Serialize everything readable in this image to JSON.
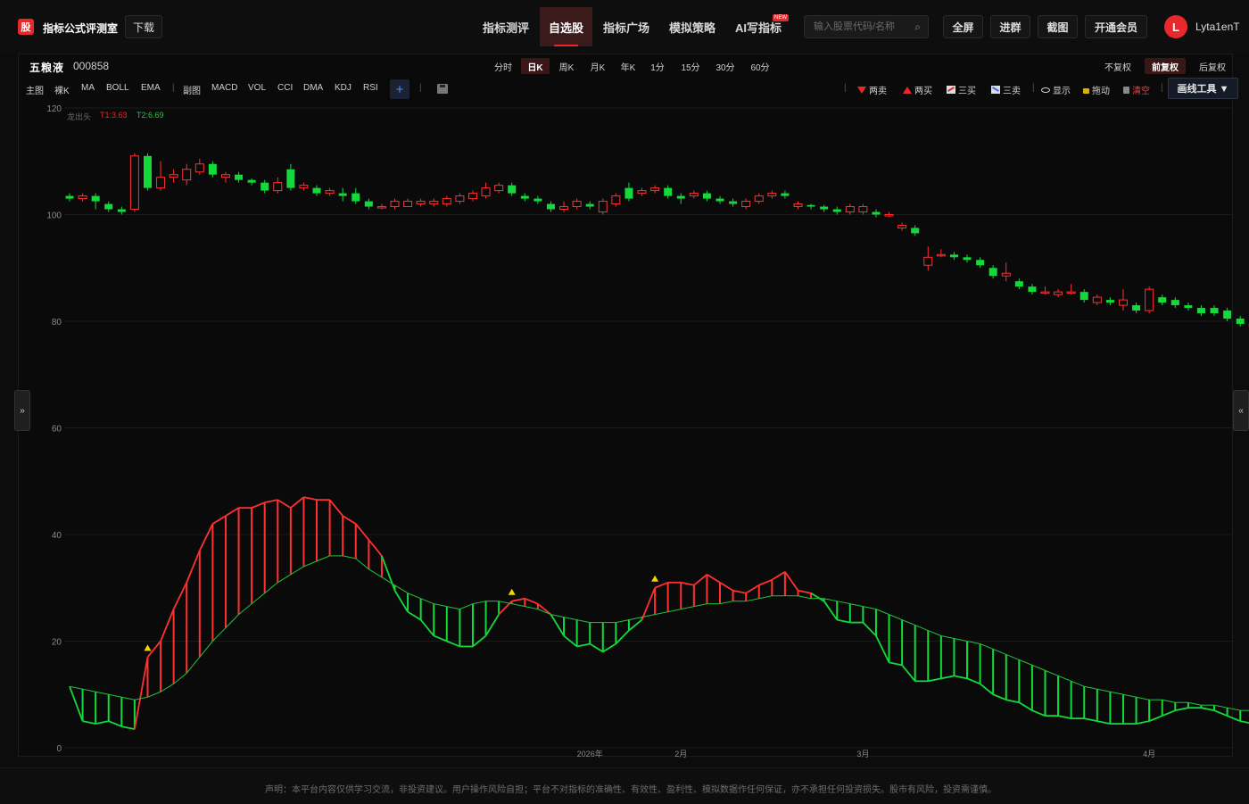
{
  "app": {
    "logo_char": "股",
    "title": "指标公式评测室",
    "download": "下载"
  },
  "nav": [
    "指标测评",
    "自选股",
    "指标广场",
    "模拟策略",
    "AI写指标"
  ],
  "nav_badge": "NEW",
  "search": {
    "placeholder": "输入股票代码/名称"
  },
  "top_buttons": [
    "全屏",
    "进群",
    "截图",
    "开通会员"
  ],
  "user": {
    "initial": "L",
    "name": "Lyta1enT"
  },
  "stock": {
    "name": "五粮液",
    "code": "000858"
  },
  "periods": [
    "分时",
    "日K",
    "周K",
    "月K",
    "年K",
    "1分",
    "15分",
    "30分",
    "60分"
  ],
  "adjust": [
    "不复权",
    "前复权",
    "后复权"
  ],
  "indicators": {
    "main": "主图",
    "bare": "裸K",
    "ma": "MA",
    "boll": "BOLL",
    "ema": "EMA",
    "sub": "副图",
    "macd": "MACD",
    "vol": "VOL",
    "cci": "CCI",
    "dma": "DMA",
    "kdj": "KDJ",
    "rsi": "RSI",
    "plus": "+"
  },
  "signals": {
    "two_sell": "两卖",
    "two_buy": "两买",
    "three_buy": "三买",
    "three_sell": "三卖",
    "show": "显示",
    "drag": "拖动",
    "clear": "清空"
  },
  "draw_tool": "画线工具 ▼",
  "side_left": "»",
  "side_right": "«",
  "legend": {
    "name": "龙出头",
    "t1": "T1:3.63",
    "t2": "T2:6.69"
  },
  "colors": {
    "up": "#ff3030",
    "down": "#13d93a",
    "accent": "#e8282b",
    "t2": "#22cc33"
  },
  "footer": "声明：本平台内容仅供学习交流，非投资建议。用户操作风险自担；平台不对指标的准确性、有效性、盈利性、模拟数据作任何保证，亦不承担任何投资损失。股市有风险，投资需谨慎。",
  "chart_data": {
    "type": "candlestick+indicator",
    "y_ticks": [
      0,
      20,
      40,
      60,
      80,
      100,
      120
    ],
    "ylim": [
      0,
      120
    ],
    "x_ticks": [
      "2026年",
      "2月",
      "3月",
      "4月"
    ],
    "x_tick_index": [
      40,
      47,
      61,
      83
    ],
    "candles": [
      {
        "o": 103.5,
        "c": 103,
        "h": 104,
        "l": 102.5
      },
      {
        "o": 103,
        "c": 103.5,
        "h": 104,
        "l": 102.5
      },
      {
        "o": 103.5,
        "c": 102.5,
        "h": 104,
        "l": 101
      },
      {
        "o": 102,
        "c": 101,
        "h": 102.5,
        "l": 100.5
      },
      {
        "o": 101,
        "c": 100.5,
        "h": 101.5,
        "l": 100
      },
      {
        "o": 101,
        "c": 111,
        "h": 111.5,
        "l": 100.5
      },
      {
        "o": 111,
        "c": 105,
        "h": 111.5,
        "l": 104.5
      },
      {
        "o": 105,
        "c": 107,
        "h": 110,
        "l": 104.5
      },
      {
        "o": 107,
        "c": 107.5,
        "h": 108.5,
        "l": 106
      },
      {
        "o": 106.5,
        "c": 108.5,
        "h": 109.5,
        "l": 105.5
      },
      {
        "o": 108,
        "c": 109.5,
        "h": 110.5,
        "l": 107.5
      },
      {
        "o": 109.5,
        "c": 107.5,
        "h": 110,
        "l": 107
      },
      {
        "o": 107,
        "c": 107.5,
        "h": 108,
        "l": 106
      },
      {
        "o": 107.5,
        "c": 106.5,
        "h": 108,
        "l": 106
      },
      {
        "o": 106.5,
        "c": 106,
        "h": 106.8,
        "l": 105.5
      },
      {
        "o": 106,
        "c": 104.5,
        "h": 106.5,
        "l": 104
      },
      {
        "o": 104.5,
        "c": 106,
        "h": 107,
        "l": 104
      },
      {
        "o": 108.5,
        "c": 105,
        "h": 109.5,
        "l": 104.5
      },
      {
        "o": 105,
        "c": 105.5,
        "h": 106,
        "l": 104.5
      },
      {
        "o": 105,
        "c": 104,
        "h": 105.5,
        "l": 103.5
      },
      {
        "o": 104,
        "c": 104.5,
        "h": 105,
        "l": 103.5
      },
      {
        "o": 104,
        "c": 103.5,
        "h": 105,
        "l": 102.5
      },
      {
        "o": 104,
        "c": 102.5,
        "h": 105,
        "l": 102
      },
      {
        "o": 102.5,
        "c": 101.5,
        "h": 103,
        "l": 101
      },
      {
        "o": 101.5,
        "c": 101.5,
        "h": 102,
        "l": 101
      },
      {
        "o": 101.5,
        "c": 102.5,
        "h": 103,
        "l": 101
      },
      {
        "o": 101.5,
        "c": 102.5,
        "h": 103,
        "l": 101.5
      },
      {
        "o": 102,
        "c": 102.5,
        "h": 103,
        "l": 101.5
      },
      {
        "o": 102,
        "c": 102.5,
        "h": 103,
        "l": 101.5
      },
      {
        "o": 102,
        "c": 103,
        "h": 103.5,
        "l": 101.5
      },
      {
        "o": 102.5,
        "c": 103.5,
        "h": 104,
        "l": 102
      },
      {
        "o": 103,
        "c": 104,
        "h": 104.5,
        "l": 102.5
      },
      {
        "o": 103.5,
        "c": 105,
        "h": 106,
        "l": 103
      },
      {
        "o": 104.5,
        "c": 105.5,
        "h": 106,
        "l": 104
      },
      {
        "o": 105.5,
        "c": 104,
        "h": 106,
        "l": 103.5
      },
      {
        "o": 103.5,
        "c": 103,
        "h": 104,
        "l": 102.5
      },
      {
        "o": 103,
        "c": 102.5,
        "h": 103.5,
        "l": 102
      },
      {
        "o": 102,
        "c": 101,
        "h": 102.5,
        "l": 100.5
      },
      {
        "o": 101,
        "c": 101.5,
        "h": 102.5,
        "l": 100.5
      },
      {
        "o": 101.5,
        "c": 102.5,
        "h": 103,
        "l": 101
      },
      {
        "o": 102,
        "c": 101.5,
        "h": 102.5,
        "l": 101
      },
      {
        "o": 100.5,
        "c": 102.5,
        "h": 103,
        "l": 100
      },
      {
        "o": 102,
        "c": 103.5,
        "h": 104,
        "l": 101.5
      },
      {
        "o": 105,
        "c": 103,
        "h": 106,
        "l": 102.5
      },
      {
        "o": 104,
        "c": 104.5,
        "h": 105,
        "l": 103.5
      },
      {
        "o": 104.5,
        "c": 105,
        "h": 105.5,
        "l": 104
      },
      {
        "o": 105,
        "c": 103.5,
        "h": 105.5,
        "l": 103
      },
      {
        "o": 103.5,
        "c": 103,
        "h": 104,
        "l": 102
      },
      {
        "o": 103.5,
        "c": 104,
        "h": 104.5,
        "l": 103
      },
      {
        "o": 104,
        "c": 103,
        "h": 104.5,
        "l": 102.5
      },
      {
        "o": 103,
        "c": 102.5,
        "h": 103.5,
        "l": 102
      },
      {
        "o": 102.5,
        "c": 102,
        "h": 103,
        "l": 101.5
      },
      {
        "o": 101.5,
        "c": 102.5,
        "h": 103,
        "l": 101
      },
      {
        "o": 102.5,
        "c": 103.5,
        "h": 104,
        "l": 102
      },
      {
        "o": 103.5,
        "c": 104,
        "h": 104.5,
        "l": 103
      },
      {
        "o": 104,
        "c": 103.5,
        "h": 104.5,
        "l": 103
      },
      {
        "o": 101.5,
        "c": 102,
        "h": 102.5,
        "l": 101
      },
      {
        "o": 101.8,
        "c": 101.5,
        "h": 102,
        "l": 101
      },
      {
        "o": 101.5,
        "c": 101,
        "h": 101.8,
        "l": 100.5
      },
      {
        "o": 101,
        "c": 100.5,
        "h": 101.5,
        "l": 100
      },
      {
        "o": 100.5,
        "c": 101.5,
        "h": 102,
        "l": 100
      },
      {
        "o": 100.5,
        "c": 101.5,
        "h": 102,
        "l": 100
      },
      {
        "o": 100.5,
        "c": 100,
        "h": 101,
        "l": 99.5
      },
      {
        "o": 100,
        "c": 100,
        "h": 100.5,
        "l": 99.5
      },
      {
        "o": 97.5,
        "c": 98,
        "h": 98.5,
        "l": 97
      },
      {
        "o": 97.5,
        "c": 96.5,
        "h": 98,
        "l": 96
      },
      {
        "o": 90.5,
        "c": 92,
        "h": 94,
        "l": 89.5
      },
      {
        "o": 92.5,
        "c": 92.5,
        "h": 93.5,
        "l": 92
      },
      {
        "o": 92.5,
        "c": 92,
        "h": 93,
        "l": 91.5
      },
      {
        "o": 92,
        "c": 91.5,
        "h": 92.5,
        "l": 91
      },
      {
        "o": 91.5,
        "c": 90.5,
        "h": 92,
        "l": 90
      },
      {
        "o": 90,
        "c": 88.5,
        "h": 90.5,
        "l": 88
      },
      {
        "o": 88.5,
        "c": 89,
        "h": 91,
        "l": 87.5
      },
      {
        "o": 87.5,
        "c": 86.5,
        "h": 88,
        "l": 86
      },
      {
        "o": 86.5,
        "c": 85.5,
        "h": 87,
        "l": 85
      },
      {
        "o": 85.5,
        "c": 85.5,
        "h": 86.5,
        "l": 85
      },
      {
        "o": 85,
        "c": 85.5,
        "h": 86,
        "l": 84.5
      },
      {
        "o": 85.5,
        "c": 85.5,
        "h": 87,
        "l": 85
      },
      {
        "o": 85.5,
        "c": 84,
        "h": 86,
        "l": 83.5
      },
      {
        "o": 83.5,
        "c": 84.5,
        "h": 85,
        "l": 83
      },
      {
        "o": 84,
        "c": 83.5,
        "h": 84.5,
        "l": 83
      },
      {
        "o": 83,
        "c": 84,
        "h": 86,
        "l": 82
      },
      {
        "o": 83,
        "c": 82,
        "h": 83.5,
        "l": 81.5
      },
      {
        "o": 82,
        "c": 86,
        "h": 86.5,
        "l": 81.5
      },
      {
        "o": 84.5,
        "c": 83.5,
        "h": 85,
        "l": 83
      },
      {
        "o": 84,
        "c": 83,
        "h": 84.5,
        "l": 82.5
      },
      {
        "o": 83,
        "c": 82.5,
        "h": 83.5,
        "l": 82
      },
      {
        "o": 82.5,
        "c": 81.5,
        "h": 83,
        "l": 81
      },
      {
        "o": 82.5,
        "c": 81.5,
        "h": 83,
        "l": 81
      },
      {
        "o": 82,
        "c": 80.5,
        "h": 82.5,
        "l": 80
      },
      {
        "o": 80.5,
        "c": 79.5,
        "h": 81,
        "l": 79
      },
      {
        "o": 79,
        "c": 79.5,
        "h": 80,
        "l": 78.5
      }
    ],
    "series_red": [
      11.5,
      5,
      4.5,
      5,
      4,
      3.5,
      17,
      20,
      26,
      31,
      37,
      42,
      43.5,
      45,
      45,
      46,
      46.5,
      45,
      47,
      46.5,
      46.5,
      43.5,
      42,
      39,
      36,
      29.5,
      25.5,
      24,
      21,
      20,
      19,
      19,
      21,
      25,
      27.5,
      28,
      27,
      25,
      21,
      19,
      19.5,
      18,
      19.5,
      22,
      24,
      30,
      31,
      31,
      30.5,
      32.5,
      31,
      29.5,
      29,
      30.5,
      31.5,
      33,
      29.5,
      29,
      27.5,
      24,
      23.5,
      23.5,
      21,
      16,
      15.5,
      12.5,
      12.5,
      13,
      13.5,
      13,
      12,
      10,
      9,
      8.5,
      7,
      6,
      6,
      5.5,
      5.5,
      5,
      4.5,
      4.5,
      4.5,
      5,
      6,
      7,
      7.5,
      7.5,
      7,
      6,
      5,
      4.5,
      4,
      4
    ],
    "series_green": [
      11.5,
      11,
      10.5,
      10,
      9.5,
      9,
      9.5,
      10.5,
      12,
      14,
      17,
      20,
      22.5,
      25,
      27,
      29,
      31,
      32.5,
      34,
      35,
      36,
      36,
      35.5,
      33.5,
      32,
      30.5,
      29,
      28,
      27,
      26.5,
      26,
      27,
      27.5,
      27.5,
      27,
      26.5,
      26,
      25,
      24.5,
      24,
      23.5,
      23.5,
      23.5,
      24,
      24.5,
      25,
      25.5,
      26,
      26.5,
      27,
      27,
      27.5,
      27.5,
      28,
      28.5,
      28.5,
      28.5,
      28,
      28,
      27.5,
      27,
      26.5,
      26,
      25,
      24,
      23,
      22,
      21,
      20.5,
      20,
      19.5,
      18.5,
      17.5,
      16.5,
      15.5,
      14.5,
      13.5,
      12.5,
      11.5,
      11,
      10.5,
      10,
      9.5,
      9,
      9,
      8.5,
      8.5,
      8,
      8,
      7.5,
      7,
      7,
      6.5,
      6
    ]
  }
}
